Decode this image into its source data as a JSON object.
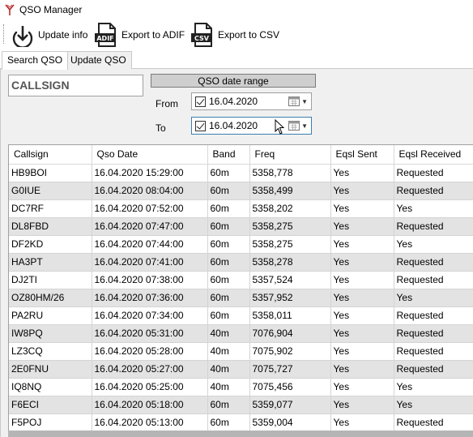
{
  "window": {
    "title": "QSO Manager"
  },
  "toolbar": {
    "update_info": "Update info",
    "export_adif": "Export to ADIF",
    "export_csv": "Export to CSV",
    "adif_badge": "ADIF",
    "csv_badge": "CSV"
  },
  "tabs": [
    {
      "label": "Search QSO",
      "active": true
    },
    {
      "label": "Update QSO",
      "active": false
    }
  ],
  "search": {
    "callsign_value": "CALLSIGN",
    "date_range_label": "QSO date range",
    "from_label": "From",
    "to_label": "To",
    "from_value": "16.04.2020",
    "to_value": "16.04.2020",
    "from_checked": true,
    "to_checked": true
  },
  "table": {
    "columns": [
      "Callsign",
      "Qso Date",
      "Band",
      "Freq",
      "Eqsl Sent",
      "Eqsl Received"
    ],
    "rows": [
      [
        "HB9BOI",
        "16.04.2020 15:29:00",
        "60m",
        "5358,778",
        "Yes",
        "Requested"
      ],
      [
        "G0IUE",
        "16.04.2020 08:04:00",
        "60m",
        "5358,499",
        "Yes",
        "Requested"
      ],
      [
        "DC7RF",
        "16.04.2020 07:52:00",
        "60m",
        "5358,202",
        "Yes",
        "Yes"
      ],
      [
        "DL8FBD",
        "16.04.2020 07:47:00",
        "60m",
        "5358,275",
        "Yes",
        "Requested"
      ],
      [
        "DF2KD",
        "16.04.2020 07:44:00",
        "60m",
        "5358,275",
        "Yes",
        "Yes"
      ],
      [
        "HA3PT",
        "16.04.2020 07:41:00",
        "60m",
        "5358,278",
        "Yes",
        "Requested"
      ],
      [
        "DJ2TI",
        "16.04.2020 07:38:00",
        "60m",
        "5357,524",
        "Yes",
        "Requested"
      ],
      [
        "OZ80HM/26",
        "16.04.2020 07:36:00",
        "60m",
        "5357,952",
        "Yes",
        "Yes"
      ],
      [
        "PA2RU",
        "16.04.2020 07:34:00",
        "60m",
        "5358,011",
        "Yes",
        "Requested"
      ],
      [
        "IW8PQ",
        "16.04.2020 05:31:00",
        "40m",
        "7076,904",
        "Yes",
        "Requested"
      ],
      [
        "LZ3CQ",
        "16.04.2020 05:28:00",
        "40m",
        "7075,902",
        "Yes",
        "Requested"
      ],
      [
        "2E0FNU",
        "16.04.2020 05:27:00",
        "40m",
        "7075,727",
        "Yes",
        "Requested"
      ],
      [
        "IQ8NQ",
        "16.04.2020 05:25:00",
        "40m",
        "7075,456",
        "Yes",
        "Yes"
      ],
      [
        "F6ECI",
        "16.04.2020 05:18:00",
        "60m",
        "5359,077",
        "Yes",
        "Yes"
      ],
      [
        "F5POJ",
        "16.04.2020 05:13:00",
        "60m",
        "5359,004",
        "Yes",
        "Requested"
      ]
    ]
  }
}
